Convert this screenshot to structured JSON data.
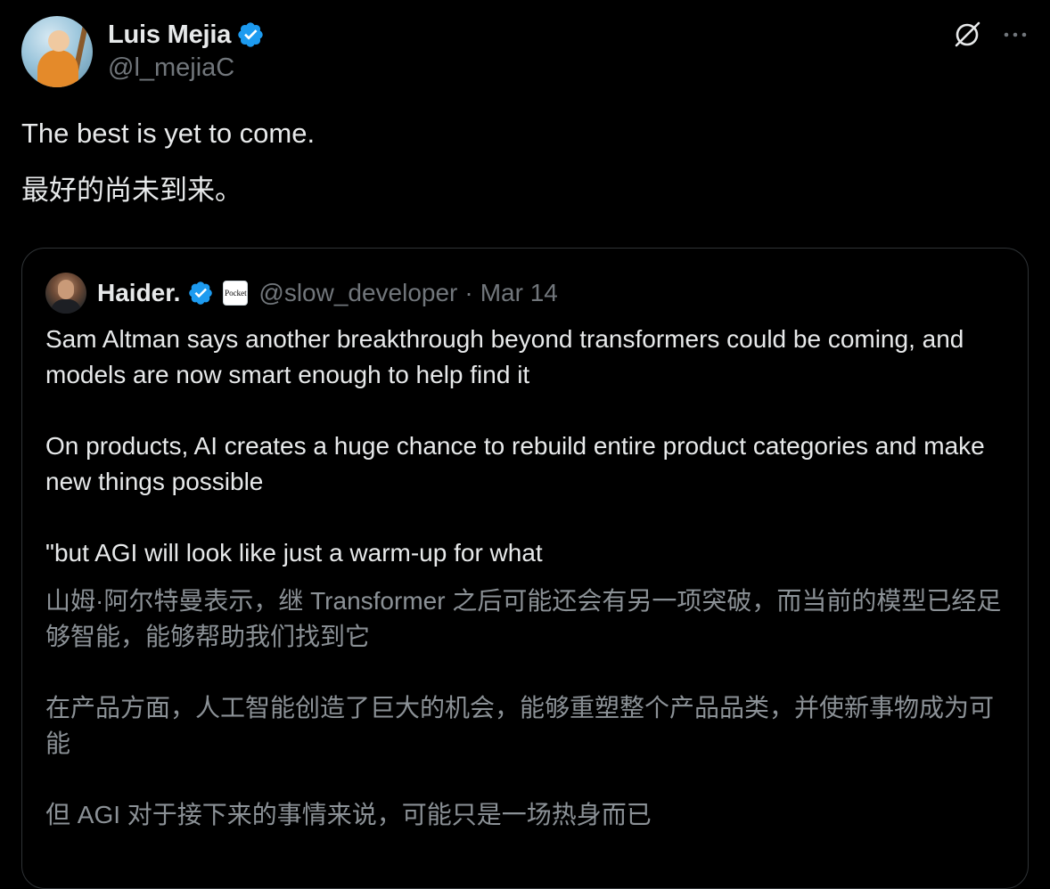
{
  "tweet": {
    "author": {
      "display_name": "Luis Mejia",
      "handle": "@l_mejiaC",
      "verified": true,
      "avatar_icon": "avatar-image"
    },
    "actions": {
      "grok_icon": "grok-icon",
      "more_icon": "more-icon"
    },
    "text": "The best is yet to come.",
    "translation": "最好的尚未到来。"
  },
  "quote": {
    "author": {
      "display_name": "Haider.",
      "verified": true,
      "affiliate_badge": "Pocket",
      "handle": "@slow_developer",
      "separator": "·",
      "date": "Mar 14"
    },
    "paragraphs": [
      "Sam Altman says another breakthrough beyond transformers could be coming, and models are now smart enough to help find it",
      "On products, AI creates a huge chance to rebuild entire product categories and make new things possible",
      "\"but AGI will look like just a warm-up for what"
    ],
    "translations": [
      "山姆·阿尔特曼表示，继 Transformer 之后可能还会有另一项突破，而当前的模型已经足够智能，能够帮助我们找到它",
      "在产品方面，人工智能创造了巨大的机会，能够重塑整个产品品类，并使新事物成为可能",
      "但 AGI 对于接下来的事情来说，可能只是一场热身而已"
    ]
  },
  "colors": {
    "background": "#000000",
    "text_primary": "#e7e9ea",
    "text_secondary": "#71767b",
    "translation_text": "#8b9196",
    "border": "#2f3336",
    "verified_blue": "#1d9bf0"
  }
}
